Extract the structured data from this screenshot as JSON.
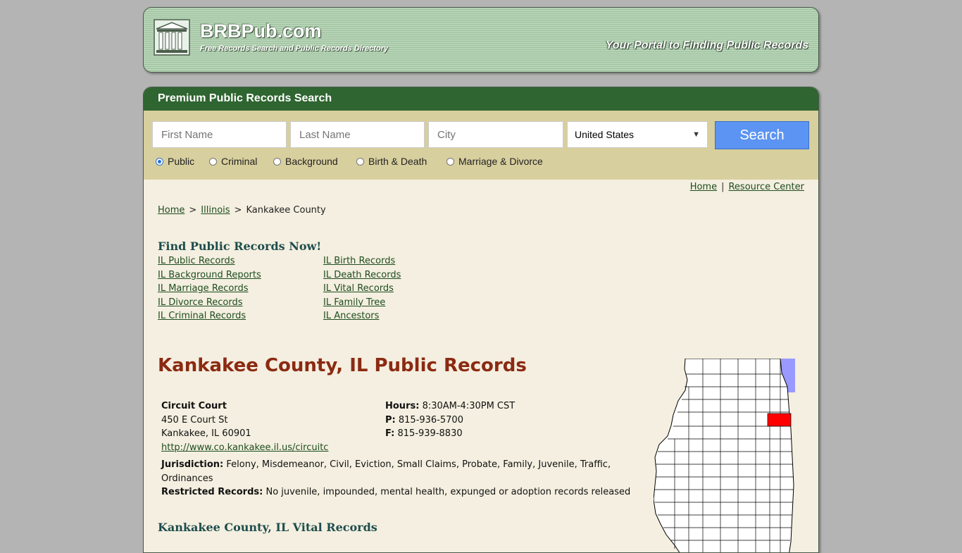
{
  "header": {
    "site_name": "BRBPub.com",
    "tagline": "Free Records Search and Public Records Directory",
    "portal_text": "Your Portal to Finding Public Records"
  },
  "search": {
    "title": "Premium Public Records Search",
    "first_name_placeholder": "First Name",
    "last_name_placeholder": "Last Name",
    "city_placeholder": "City",
    "country_value": "United States",
    "button_label": "Search",
    "record_types": [
      {
        "label": "Public",
        "checked": true
      },
      {
        "label": "Criminal",
        "checked": false
      },
      {
        "label": "Background",
        "checked": false
      },
      {
        "label": "Birth & Death",
        "checked": false
      },
      {
        "label": "Marriage & Divorce",
        "checked": false
      }
    ]
  },
  "top_links": {
    "home": "Home",
    "separator": "|",
    "resource_center": "Resource Center"
  },
  "breadcrumb": {
    "home": "Home",
    "state": "Illinois",
    "current": "Kankakee County",
    "separator": ">"
  },
  "find_records": {
    "heading": "Find Public Records Now!",
    "left_links": [
      "IL Public Records",
      "IL Background Reports",
      "IL Marriage Records",
      "IL Divorce Records",
      "IL Criminal Records"
    ],
    "right_links": [
      "IL Birth Records",
      "IL Death Records",
      "IL Vital Records",
      "IL Family Tree",
      "IL Ancestors"
    ]
  },
  "county": {
    "title": "Kankakee County, IL Public Records",
    "court": {
      "name": "Circuit Court",
      "address1": "450 E Court St",
      "address2": "Kankakee, IL 60901",
      "url": "http://www.co.kankakee.il.us/circuitc",
      "hours_label": "Hours:",
      "hours": "8:30AM-4:30PM CST",
      "phone_label": "P:",
      "phone": "815-936-5700",
      "fax_label": "F:",
      "fax": "815-939-8830",
      "jurisdiction_label": "Jurisdiction:",
      "jurisdiction": "Felony, Misdemeanor, Civil, Eviction, Small Claims, Probate, Family, Juvenile, Traffic, Ordinances",
      "restricted_label": "Restricted Records:",
      "restricted": "No juvenile, impounded, mental health, expunged or adoption records released"
    },
    "vital_heading": "Kankakee County, IL Vital Records"
  },
  "colors": {
    "title_bar": "#2f6530",
    "search_panel": "#d8cf9e",
    "content_bg": "#f4efe0",
    "county_title": "#8b2a12",
    "search_button": "#5b94f2",
    "map_highlight": "#ff0000",
    "lake_michigan": "#9999ff"
  }
}
